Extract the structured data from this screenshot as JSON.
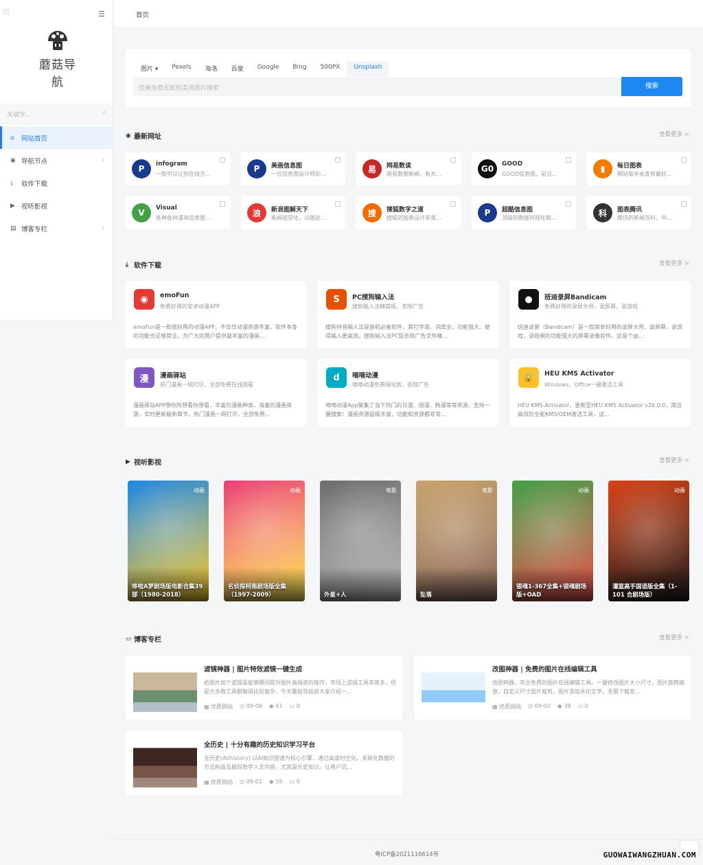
{
  "sidebar": {
    "logo_text": "蘑菇导航",
    "search_placeholder": "关键字...",
    "items": [
      {
        "label": "网站首页"
      },
      {
        "label": "导航节点"
      },
      {
        "label": "软件下载"
      },
      {
        "label": "视听影视"
      },
      {
        "label": "博客专栏"
      }
    ]
  },
  "topbar": {
    "breadcrumb": "首页"
  },
  "search": {
    "tabs": [
      "图片",
      "Pexels",
      "海洛",
      "百度",
      "Google",
      "Bing",
      "500PX",
      "Unsplash"
    ],
    "active_tab": "Unsplash",
    "placeholder": "优美免费无版权高清图片搜索",
    "button": "搜索"
  },
  "sections": {
    "latest": "最新网址",
    "software": "软件下载",
    "media": "视听影视",
    "blog": "博客专栏",
    "more": "查看更多 >"
  },
  "sites": [
    {
      "name": "infogram",
      "desc": "一款可以让你在线方...",
      "color": "#1a3a8c",
      "icon": "P"
    },
    {
      "name": "美画信息图",
      "desc": "一位信息图设计师的...",
      "color": "#1a3a8c",
      "icon": "P"
    },
    {
      "name": "网易数读",
      "desc": "网易数据新闻，有大...",
      "color": "#c62828",
      "icon": "易"
    },
    {
      "name": "GOOD",
      "desc": "GOOD信息图，前沿...",
      "color": "#111111",
      "icon": "G0"
    },
    {
      "name": "每日图表",
      "desc": "网站每天会发布最好...",
      "color": "#f57c00",
      "icon": "▮"
    },
    {
      "name": "Visual",
      "desc": "各种各样漂亮信息图...",
      "color": "#43a047",
      "icon": "V"
    },
    {
      "name": "新浪图解天下",
      "desc": "新闻视觉化，以图达...",
      "color": "#e53935",
      "icon": "浪"
    },
    {
      "name": "搜狐数字之道",
      "desc": "搜狐的图表设计非常...",
      "color": "#ef6c00",
      "icon": "搜"
    },
    {
      "name": "超酷信息图",
      "desc": "顶级的数据可视化和...",
      "color": "#1a3a8c",
      "icon": "P"
    },
    {
      "name": "图表腾讯",
      "desc": "腾讯的新闻百科，中...",
      "color": "#333333",
      "icon": "科"
    }
  ],
  "software": [
    {
      "name": "emoFun",
      "sub": "免费好用的安卓动漫APP",
      "desc": "emoFun是一款很好用的动漫APP。不仅仅动漫资源丰富，软件本身的功能也足够简洁，为广大的用户提供最丰富的漫画...",
      "color": "#e53935",
      "icon": "◉"
    },
    {
      "name": "PC搜狗输入法",
      "sub": "搜狗输入法精简版，去除广告",
      "desc": "搜狗拼音输入法是装机必备软件，其打字准、词库全、功能强大、使得输入更高效。搜狗输入法PC版去除广告文件精...",
      "color": "#e65100",
      "icon": "S"
    },
    {
      "name": "班迪录屏Bandicam",
      "sub": "免费好用的录屏大师，录屏幕，录游戏",
      "desc": "班迪录屏（Bandicam）是一款简单好用的录屏大师，录屏幕，录游戏，录视频的功能强大的屏幕录像软件。这是个由...",
      "color": "#111111",
      "icon": "●"
    },
    {
      "name": "漫画驿站",
      "sub": "热门漫画一网打尽，全部免费在线观看",
      "desc": "漫画驿站APP想你所想看你想看，丰富的漫画种类，海量的漫画资源，实时更新最新章节，热门漫画一网打尽，全部免费...",
      "color": "#7e57c2",
      "icon": "漫"
    },
    {
      "name": "嘀嘀动漫",
      "sub": "嘀嘀动漫免费绿化版，去除广告",
      "desc": "嘀嘀动漫App聚集了当下热门的日漫、国漫、韩漫等等资源，支持一键搜索！漫画资源超级丰富，功能和资源都非常...",
      "color": "#00acc1",
      "icon": "d"
    },
    {
      "name": "HEU KMS Activator",
      "sub": "Windows、Office一键激活工具",
      "desc": "HEU KMS Activator，更新至HEU KMS Activator v26.0.0，简洁高效的全能KMS/OEM激活工具，适...",
      "color": "#fbc02d",
      "icon": "🔒"
    }
  ],
  "media": [
    {
      "badge": "动画",
      "title": "哆啦A梦剧场版电影合集39部（1980-2018）",
      "bg": "#1e88e5",
      "bg2": "#ffca28"
    },
    {
      "badge": "动画",
      "title": "名侦探柯南剧场版全集（1997-2009）",
      "bg": "#ec407a",
      "bg2": "#ffee58"
    },
    {
      "badge": "电影",
      "title": "外星+人",
      "bg": "#6d6d6d",
      "bg2": "#bdbdbd"
    },
    {
      "badge": "电影",
      "title": "坠落",
      "bg": "#c9a36b",
      "bg2": "#8d6e63"
    },
    {
      "badge": "动画",
      "title": "银魂1-367全集+银魂剧场版+OAD",
      "bg": "#43a047",
      "bg2": "#ef5350"
    },
    {
      "badge": "动画",
      "title": "灌篮高手国语版全集（1-101 合剧场版）",
      "bg": "#d84315",
      "bg2": "#212121"
    }
  ],
  "blogs": [
    {
      "title": "滤镜神器 | 图片特效滤镜一键生成",
      "desc": "给图片加个滤镜是能够瞬间提升图片高级感的操作，市场上滤镜工具非常多，但是大多数工具都做得比较复杂，今天蘑菇导航给大家介绍一...",
      "category": "优质网站",
      "date": "09-06",
      "views": "41",
      "comments": "0"
    },
    {
      "title": "改图神器 | 免费的图片在线编辑工具",
      "desc": "改图神器，完全免费的图片在线编辑工具。一键修改图片大小尺寸，图片旋转缩放，自定义尺寸图片裁剪，图片添加水印文字。无需下载安...",
      "category": "优质网站",
      "date": "09-02",
      "views": "39",
      "comments": "0"
    },
    {
      "title": "全历史 | 十分有趣的历史知识学习平台",
      "desc": "全历史(Allhistory) 以AI知识图谱为核心引擎，通过高度时空化、关联化数据的方式构造及展现数字人文内容，尤其是历史知识。让用户沉...",
      "category": "优质网站",
      "date": "09-01",
      "views": "55",
      "comments": "0"
    }
  ],
  "footer": {
    "icp": "粤ICP备2021116614号"
  },
  "watermark": "GUOWAIWANGZHUAN.COM"
}
